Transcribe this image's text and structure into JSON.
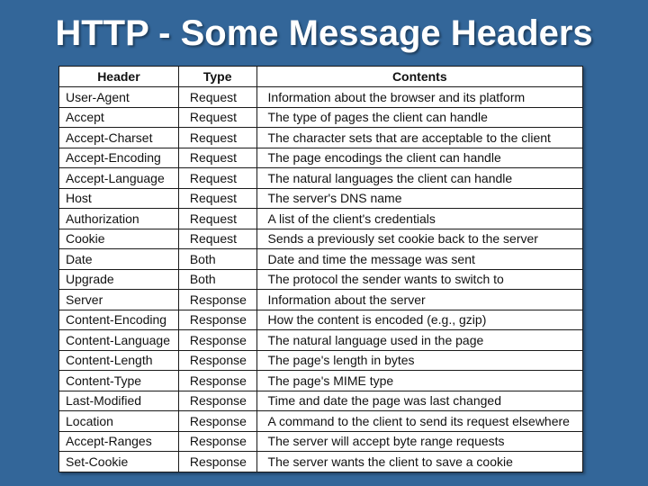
{
  "slide": {
    "title": "HTTP - Some Message Headers",
    "background_color": "#336699"
  },
  "table": {
    "columns": [
      "Header",
      "Type",
      "Contents"
    ],
    "rows": [
      {
        "header": "User-Agent",
        "type": "Request",
        "contents": "Information about the browser and its platform"
      },
      {
        "header": "Accept",
        "type": "Request",
        "contents": "The type of pages the client can handle"
      },
      {
        "header": "Accept-Charset",
        "type": "Request",
        "contents": "The character sets that are acceptable to the client"
      },
      {
        "header": "Accept-Encoding",
        "type": "Request",
        "contents": "The page encodings the client can handle"
      },
      {
        "header": "Accept-Language",
        "type": "Request",
        "contents": "The natural languages the client can handle"
      },
      {
        "header": "Host",
        "type": "Request",
        "contents": "The server's DNS name"
      },
      {
        "header": "Authorization",
        "type": "Request",
        "contents": "A list of the client's credentials"
      },
      {
        "header": "Cookie",
        "type": "Request",
        "contents": "Sends a previously set cookie back to the server"
      },
      {
        "header": "Date",
        "type": "Both",
        "contents": "Date and time the message was sent"
      },
      {
        "header": "Upgrade",
        "type": "Both",
        "contents": "The protocol the sender wants to switch to"
      },
      {
        "header": "Server",
        "type": "Response",
        "contents": "Information about the server"
      },
      {
        "header": "Content-Encoding",
        "type": "Response",
        "contents": "How the content is encoded (e.g., gzip)"
      },
      {
        "header": "Content-Language",
        "type": "Response",
        "contents": "The natural language used in the page"
      },
      {
        "header": "Content-Length",
        "type": "Response",
        "contents": "The page's length in bytes"
      },
      {
        "header": "Content-Type",
        "type": "Response",
        "contents": "The page's MIME type"
      },
      {
        "header": "Last-Modified",
        "type": "Response",
        "contents": "Time and date the page was last changed"
      },
      {
        "header": "Location",
        "type": "Response",
        "contents": "A command to the client to send its request elsewhere"
      },
      {
        "header": "Accept-Ranges",
        "type": "Response",
        "contents": "The server will accept byte range requests"
      },
      {
        "header": "Set-Cookie",
        "type": "Response",
        "contents": "The server wants the client to save a cookie"
      }
    ]
  }
}
